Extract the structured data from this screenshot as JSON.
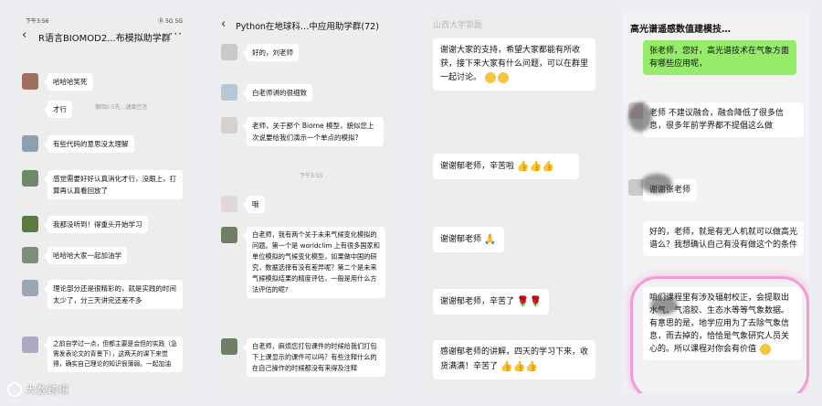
{
  "panel1": {
    "status_time": "下午3:56",
    "status_right": "Ⓡ 5G 5G",
    "title": "R语言BIOMOD2...布模拟助学群",
    "messages": [
      {
        "text": "哈哈哈笑死"
      },
      {
        "text": "才行"
      },
      {
        "text": "有些代码的意思没太理解"
      },
      {
        "text": "感觉需要好好认真消化才行，没跟上，打算再认真看回放了"
      },
      {
        "text": "我都没听到！得重头开始学习"
      },
      {
        "text": "哈哈哈大家一起加油学"
      },
      {
        "text": "理论部分还是很精彩的，就是实践的时间太少了，分三天讲完还差不多"
      },
      {
        "text": "之前自学过一点，但都主要是会但的实践（急需发表论文的背景下），这两天的课下来觉得，确实自己理论的知识很薄弱。一起加油"
      }
    ],
    "sys_note": "撤回0.5先…速度巴言"
  },
  "panel2": {
    "title": "Python在地球科…中应用助学群(72)",
    "messages": [
      {
        "text": "好的，刘老师"
      },
      {
        "text": "白老师讲的很细致"
      },
      {
        "text": "老师，关于那个 Biome 模型，貌似您上次说要给我们演示一个单点的模拟?"
      },
      {
        "text": "哦"
      },
      {
        "text": "白老师，我有两个关于未来气候变化模拟的问题。第一个是 worldclim 上有很多国家和单位模拟的气候变化模型，如果做中国的研究，数据选择有没有差异呢？第二个是未来气候模拟结果的精度评估，一般是用什么方法评估的呢?"
      },
      {
        "text": "白老师，麻烦您打包课件的时候给我们打包下上课显示的课件可以吗？有些注释什么的在自己操作的时候都没有来得及注释"
      }
    ],
    "time_note": "下午3:55"
  },
  "panel3": {
    "title": "山西大学郭磊",
    "messages": [
      {
        "text": "谢谢大家的支持，希望大家都能有所收获，接下来大家有什么问题，可以在群里一起讨论。"
      },
      {
        "text": "谢谢郁老师，辛苦啦"
      },
      {
        "text": "谢谢郁老师"
      },
      {
        "text": "谢谢郁老师，辛苦了"
      },
      {
        "text": "感谢郁老师的讲解，四天的学习下来，收货满满！辛苦了"
      }
    ]
  },
  "panel4": {
    "title": "高光谱遥感数值建模技…",
    "messages": [
      {
        "text": "张老师，您好，高光谱技术在气象方面有哪些应用呢，"
      },
      {
        "text": "老师 不建议融合，融合降低了很多信息，很多年前学界都不提倡这么做"
      },
      {
        "text": "谢谢张老师"
      },
      {
        "text": "好的，老师，就是有无人机就可以做高光谱么？我想确认自己有没有做这个的条件"
      },
      {
        "text": "咱们课程里有涉及辐射校正，会提取出水气、气溶胶、生态水等等气象数据。有意思的是，地学应用为了去除气象信息，而去掉的，恰恰是气象研究人员关心的。所以课程对你会有价值"
      }
    ]
  },
  "watermark": {
    "text": "大数跨境"
  },
  "colors": {
    "own_bubble": "#95ec69",
    "highlight": "#f29ad4"
  }
}
